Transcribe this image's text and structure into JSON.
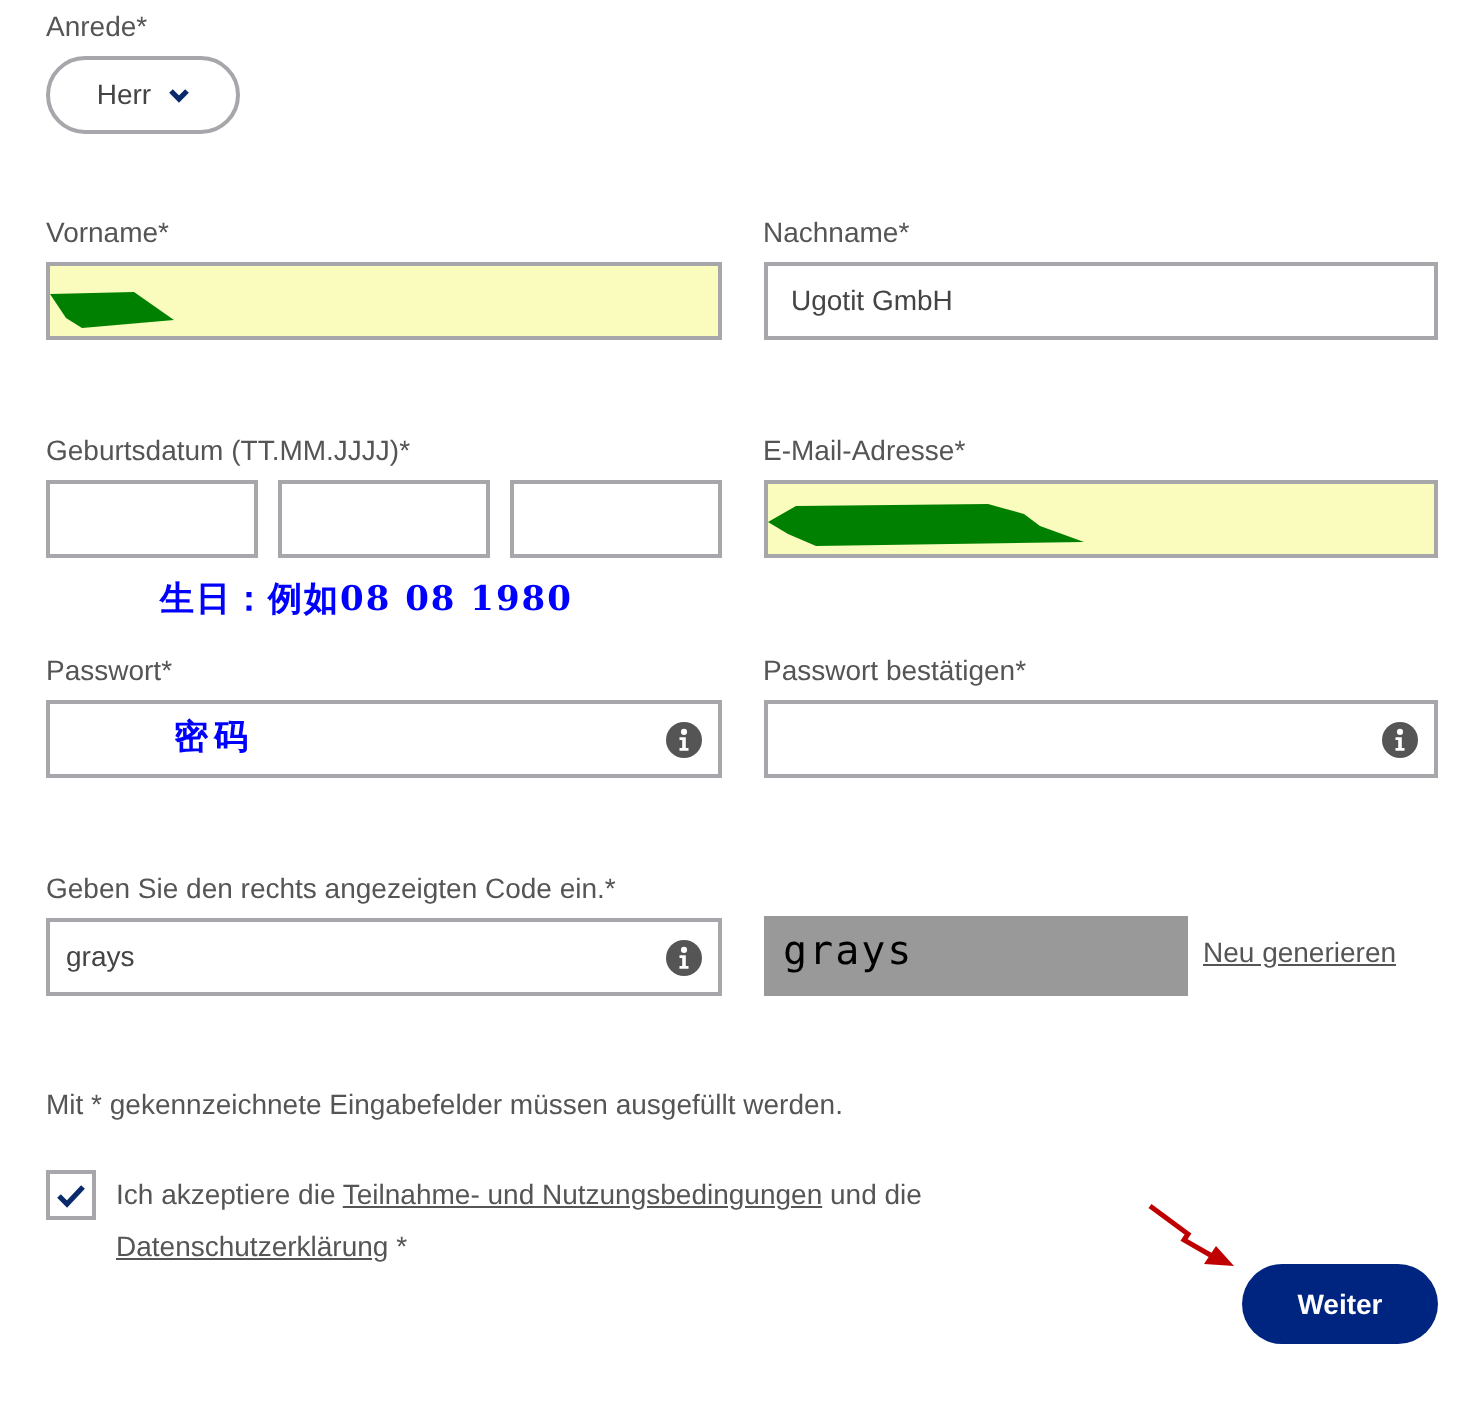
{
  "salutation": {
    "label": "Anrede*",
    "value": "Herr"
  },
  "name_row": [
    {
      "label": "Vorname*",
      "filled": true,
      "redacted": true
    },
    {
      "label": "Nachname*",
      "value": "Ugotit GmbH",
      "filled": false,
      "redacted": false
    }
  ],
  "birth_date": {
    "label": "Geburtsdatum (TT.MM.JJJJ)*",
    "annotation": "生日：例如08 08 1980"
  },
  "email": {
    "label": "E-Mail-Adresse*",
    "filled": true,
    "redacted": true
  },
  "password_row": [
    {
      "label": "Passwort*",
      "annotation": "密码"
    },
    {
      "label": "Passwort bestätigen*"
    }
  ],
  "captcha": {
    "label": "Geben Sie den rechts angezeigten Code ein.*",
    "value": "grays",
    "image_text": "grays",
    "regenerate_link": "Neu generieren"
  },
  "required_note": "Mit * gekennzeichnete Eingabefelder müssen ausgefüllt werden.",
  "consent": {
    "checked": true,
    "text_before": "Ich akzeptiere die ",
    "link_terms": "Teilnahme- und Nutzungsbedingungen",
    "text_middle": " und die ",
    "link_privacy": "Datenschutzerklärung",
    "text_after": " *"
  },
  "submit_button": "Weiter"
}
